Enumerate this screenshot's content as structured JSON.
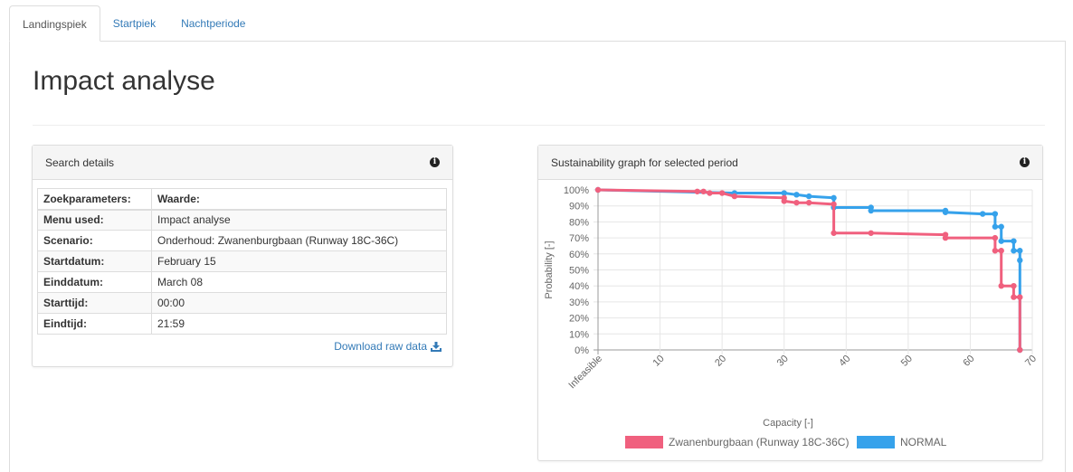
{
  "tabs": [
    {
      "label": "Landingspiek",
      "active": true
    },
    {
      "label": "Startpiek",
      "active": false
    },
    {
      "label": "Nachtperiode",
      "active": false
    }
  ],
  "page_title": "Impact analyse",
  "search_panel": {
    "title": "Search details",
    "info_icon": "info-circle-icon",
    "header": {
      "key": "Zoekparameters:",
      "value": "Waarde:"
    },
    "rows": [
      {
        "key": "Menu used:",
        "value": "Impact analyse"
      },
      {
        "key": "Scenario:",
        "value": "Onderhoud: Zwanenburgbaan (Runway 18C-36C)"
      },
      {
        "key": "Startdatum:",
        "value": "February 15"
      },
      {
        "key": "Einddatum:",
        "value": "March 08"
      },
      {
        "key": "Starttijd:",
        "value": "00:00"
      },
      {
        "key": "Eindtijd:",
        "value": "21:59"
      }
    ],
    "download_label": "Download raw data",
    "download_icon": "download-icon"
  },
  "graph_panel": {
    "title": "Sustainability graph for selected period",
    "info_icon": "info-circle-icon"
  },
  "chart_data": {
    "type": "line",
    "step": true,
    "xlabel": "Capacity [-]",
    "ylabel": "Probability [-]",
    "xlim": [
      0,
      70
    ],
    "ylim": [
      0,
      100
    ],
    "x_tick_labels": [
      "Infeasible",
      "10",
      "20",
      "30",
      "40",
      "50",
      "60",
      "70"
    ],
    "y_tick_labels": [
      "0%",
      "10%",
      "20%",
      "30%",
      "40%",
      "50%",
      "60%",
      "70%",
      "80%",
      "90%",
      "100%"
    ],
    "grid": true,
    "legend_position": "bottom",
    "series": [
      {
        "name": "Zwanenburgbaan (Runway 18C-36C)",
        "color": "#f0607e",
        "points": [
          [
            0,
            100
          ],
          [
            16,
            99
          ],
          [
            17,
            99
          ],
          [
            18,
            98
          ],
          [
            20,
            98
          ],
          [
            22,
            96
          ],
          [
            30,
            95
          ],
          [
            30,
            93
          ],
          [
            32,
            92
          ],
          [
            34,
            92
          ],
          [
            38,
            91
          ],
          [
            38,
            73
          ],
          [
            44,
            73
          ],
          [
            56,
            72
          ],
          [
            56,
            70
          ],
          [
            64,
            70
          ],
          [
            64,
            62
          ],
          [
            65,
            62
          ],
          [
            65,
            40
          ],
          [
            67,
            40
          ],
          [
            67,
            33
          ],
          [
            68,
            33
          ],
          [
            68,
            0
          ]
        ]
      },
      {
        "name": "NORMAL",
        "color": "#36a2eb",
        "points": [
          [
            0,
            100
          ],
          [
            22,
            98
          ],
          [
            30,
            98
          ],
          [
            32,
            97
          ],
          [
            34,
            96
          ],
          [
            38,
            95
          ],
          [
            38,
            89
          ],
          [
            44,
            89
          ],
          [
            44,
            87
          ],
          [
            56,
            87
          ],
          [
            56,
            86
          ],
          [
            62,
            85
          ],
          [
            64,
            85
          ],
          [
            64,
            77
          ],
          [
            65,
            77
          ],
          [
            65,
            68
          ],
          [
            67,
            68
          ],
          [
            67,
            62
          ],
          [
            68,
            62
          ],
          [
            68,
            56
          ],
          [
            68,
            0
          ]
        ]
      }
    ]
  }
}
